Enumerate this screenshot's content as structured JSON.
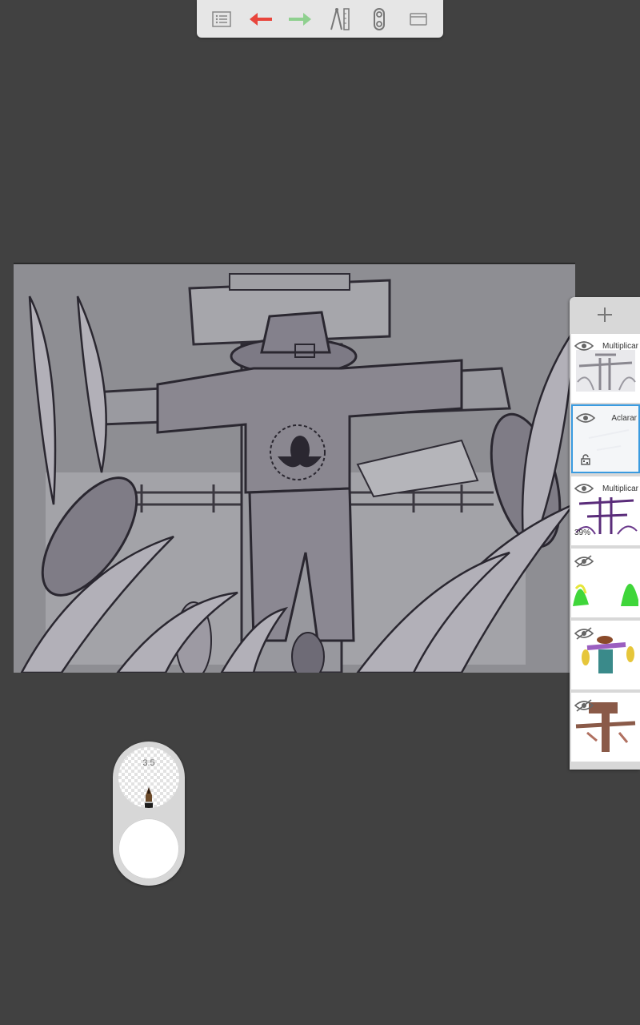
{
  "toolbar": {
    "icons": [
      "list-icon",
      "undo-arrow-icon",
      "redo-arrow-icon",
      "ruler-compass-icon",
      "symmetry-icon",
      "canvas-frame-icon"
    ],
    "undo_color": "#e8453c",
    "redo_color": "#8fd08f"
  },
  "layers_panel": {
    "add_icon": "plus-icon",
    "layers": [
      {
        "blend_mode": "Multiplicar",
        "visible": true,
        "selected": false
      },
      {
        "blend_mode": "Aclarar",
        "visible": true,
        "selected": true,
        "locked": true
      },
      {
        "blend_mode": "Multiplicar",
        "visible": true,
        "selected": false,
        "opacity": "39%"
      },
      {
        "visible": false,
        "selected": false
      },
      {
        "visible": false,
        "selected": false
      },
      {
        "visible": false,
        "selected": false
      }
    ],
    "selected_border_color": "#3a9be0"
  },
  "brush": {
    "size": "3.5",
    "tool_icon": "pen-icon",
    "color": "#ffffff"
  }
}
